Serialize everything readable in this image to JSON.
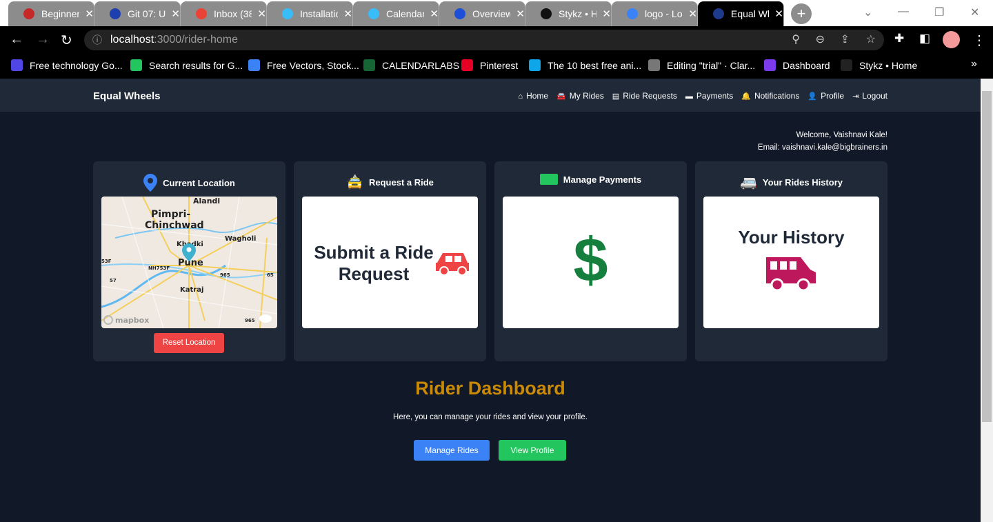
{
  "browser": {
    "tabs": [
      {
        "title": "Beginner",
        "color": "#c62828"
      },
      {
        "title": "Git 07: Up",
        "color": "#1e40af"
      },
      {
        "title": "Inbox (38",
        "color": "#ea4335"
      },
      {
        "title": "Installatio",
        "color": "#38bdf8"
      },
      {
        "title": "Calendar",
        "color": "#38bdf8"
      },
      {
        "title": "Overview",
        "color": "#1d4ed8"
      },
      {
        "title": "Stykz • H",
        "color": "#111"
      },
      {
        "title": "logo - Lo",
        "color": "#3b82f6"
      },
      {
        "title": "Equal Wh",
        "color": "#1e3a8a",
        "active": true
      }
    ],
    "url_host": "localhost",
    "url_path": ":3000/rider-home",
    "bookmarks": [
      {
        "label": "Free technology Go...",
        "color": "#4f46e5"
      },
      {
        "label": "Search results for G...",
        "color": "#22c55e"
      },
      {
        "label": "Free Vectors, Stock...",
        "color": "#3b82f6"
      },
      {
        "label": "CALENDARLABS",
        "color": "#166534"
      },
      {
        "label": "Pinterest",
        "color": "#e60023"
      },
      {
        "label": "The 10 best free ani...",
        "color": "#0ea5e9"
      },
      {
        "label": "Editing \"trial\" · Clar...",
        "color": "#777"
      },
      {
        "label": "Dashboard",
        "color": "#7c3aed"
      },
      {
        "label": "Stykz • Home",
        "color": "#222"
      }
    ]
  },
  "app": {
    "brand": "Equal Wheels",
    "nav": [
      {
        "icon": "home-icon",
        "glyph": "⌂",
        "label": "Home"
      },
      {
        "icon": "car-icon",
        "glyph": "🚘",
        "label": "My Rides"
      },
      {
        "icon": "clipboard-icon",
        "glyph": "▤",
        "label": "Ride Requests"
      },
      {
        "icon": "wallet-icon",
        "glyph": "▬",
        "label": "Payments"
      },
      {
        "icon": "bell-icon",
        "glyph": "🔔",
        "label": "Notifications"
      },
      {
        "icon": "user-icon",
        "glyph": "👤",
        "label": "Profile"
      },
      {
        "icon": "logout-icon",
        "glyph": "⇥",
        "label": "Logout"
      }
    ],
    "welcome": "Welcome, Vaishnavi Kale!",
    "email": "Email: vaishnavi.kale@bigbrainers.in",
    "cards": [
      {
        "title": "Current Location",
        "icon_color": "#3b82f6",
        "button": "Reset Location",
        "map": {
          "labels": [
            "Alandi",
            "Pimpri-",
            "Chinchwad",
            "Khadki",
            "Wagholi",
            "Pune",
            "Katraj",
            "NH753F",
            "53F",
            "57",
            "965",
            "65",
            "965"
          ],
          "attribution": "mapbox"
        }
      },
      {
        "title": "Request a Ride",
        "icon_color": "#eab308",
        "panel_text_1": "Submit a Ride",
        "panel_text_2": "Request",
        "panel_icon_color": "#ef4444"
      },
      {
        "title": "Manage Payments",
        "icon_color": "#22c55e",
        "panel_icon": "$",
        "panel_icon_color": "#15803d"
      },
      {
        "title": "Your Rides History",
        "icon_color": "#ec4899",
        "panel_text_1": "Your History",
        "panel_icon_color": "#be185d"
      }
    ],
    "dashboard_title": "Rider Dashboard",
    "dashboard_sub": "Here, you can manage your rides and view your profile.",
    "manage_rides": "Manage Rides",
    "view_profile": "View Profile"
  }
}
